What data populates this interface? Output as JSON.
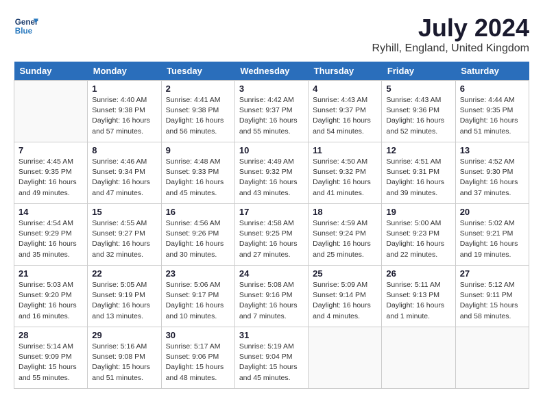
{
  "logo": {
    "line1": "General",
    "line2": "Blue"
  },
  "title": "July 2024",
  "location": "Ryhill, England, United Kingdom",
  "weekdays": [
    "Sunday",
    "Monday",
    "Tuesday",
    "Wednesday",
    "Thursday",
    "Friday",
    "Saturday"
  ],
  "weeks": [
    [
      {
        "day": "",
        "info": ""
      },
      {
        "day": "1",
        "info": "Sunrise: 4:40 AM\nSunset: 9:38 PM\nDaylight: 16 hours\nand 57 minutes."
      },
      {
        "day": "2",
        "info": "Sunrise: 4:41 AM\nSunset: 9:38 PM\nDaylight: 16 hours\nand 56 minutes."
      },
      {
        "day": "3",
        "info": "Sunrise: 4:42 AM\nSunset: 9:37 PM\nDaylight: 16 hours\nand 55 minutes."
      },
      {
        "day": "4",
        "info": "Sunrise: 4:43 AM\nSunset: 9:37 PM\nDaylight: 16 hours\nand 54 minutes."
      },
      {
        "day": "5",
        "info": "Sunrise: 4:43 AM\nSunset: 9:36 PM\nDaylight: 16 hours\nand 52 minutes."
      },
      {
        "day": "6",
        "info": "Sunrise: 4:44 AM\nSunset: 9:35 PM\nDaylight: 16 hours\nand 51 minutes."
      }
    ],
    [
      {
        "day": "7",
        "info": "Sunrise: 4:45 AM\nSunset: 9:35 PM\nDaylight: 16 hours\nand 49 minutes."
      },
      {
        "day": "8",
        "info": "Sunrise: 4:46 AM\nSunset: 9:34 PM\nDaylight: 16 hours\nand 47 minutes."
      },
      {
        "day": "9",
        "info": "Sunrise: 4:48 AM\nSunset: 9:33 PM\nDaylight: 16 hours\nand 45 minutes."
      },
      {
        "day": "10",
        "info": "Sunrise: 4:49 AM\nSunset: 9:32 PM\nDaylight: 16 hours\nand 43 minutes."
      },
      {
        "day": "11",
        "info": "Sunrise: 4:50 AM\nSunset: 9:32 PM\nDaylight: 16 hours\nand 41 minutes."
      },
      {
        "day": "12",
        "info": "Sunrise: 4:51 AM\nSunset: 9:31 PM\nDaylight: 16 hours\nand 39 minutes."
      },
      {
        "day": "13",
        "info": "Sunrise: 4:52 AM\nSunset: 9:30 PM\nDaylight: 16 hours\nand 37 minutes."
      }
    ],
    [
      {
        "day": "14",
        "info": "Sunrise: 4:54 AM\nSunset: 9:29 PM\nDaylight: 16 hours\nand 35 minutes."
      },
      {
        "day": "15",
        "info": "Sunrise: 4:55 AM\nSunset: 9:27 PM\nDaylight: 16 hours\nand 32 minutes."
      },
      {
        "day": "16",
        "info": "Sunrise: 4:56 AM\nSunset: 9:26 PM\nDaylight: 16 hours\nand 30 minutes."
      },
      {
        "day": "17",
        "info": "Sunrise: 4:58 AM\nSunset: 9:25 PM\nDaylight: 16 hours\nand 27 minutes."
      },
      {
        "day": "18",
        "info": "Sunrise: 4:59 AM\nSunset: 9:24 PM\nDaylight: 16 hours\nand 25 minutes."
      },
      {
        "day": "19",
        "info": "Sunrise: 5:00 AM\nSunset: 9:23 PM\nDaylight: 16 hours\nand 22 minutes."
      },
      {
        "day": "20",
        "info": "Sunrise: 5:02 AM\nSunset: 9:21 PM\nDaylight: 16 hours\nand 19 minutes."
      }
    ],
    [
      {
        "day": "21",
        "info": "Sunrise: 5:03 AM\nSunset: 9:20 PM\nDaylight: 16 hours\nand 16 minutes."
      },
      {
        "day": "22",
        "info": "Sunrise: 5:05 AM\nSunset: 9:19 PM\nDaylight: 16 hours\nand 13 minutes."
      },
      {
        "day": "23",
        "info": "Sunrise: 5:06 AM\nSunset: 9:17 PM\nDaylight: 16 hours\nand 10 minutes."
      },
      {
        "day": "24",
        "info": "Sunrise: 5:08 AM\nSunset: 9:16 PM\nDaylight: 16 hours\nand 7 minutes."
      },
      {
        "day": "25",
        "info": "Sunrise: 5:09 AM\nSunset: 9:14 PM\nDaylight: 16 hours\nand 4 minutes."
      },
      {
        "day": "26",
        "info": "Sunrise: 5:11 AM\nSunset: 9:13 PM\nDaylight: 16 hours\nand 1 minute."
      },
      {
        "day": "27",
        "info": "Sunrise: 5:12 AM\nSunset: 9:11 PM\nDaylight: 15 hours\nand 58 minutes."
      }
    ],
    [
      {
        "day": "28",
        "info": "Sunrise: 5:14 AM\nSunset: 9:09 PM\nDaylight: 15 hours\nand 55 minutes."
      },
      {
        "day": "29",
        "info": "Sunrise: 5:16 AM\nSunset: 9:08 PM\nDaylight: 15 hours\nand 51 minutes."
      },
      {
        "day": "30",
        "info": "Sunrise: 5:17 AM\nSunset: 9:06 PM\nDaylight: 15 hours\nand 48 minutes."
      },
      {
        "day": "31",
        "info": "Sunrise: 5:19 AM\nSunset: 9:04 PM\nDaylight: 15 hours\nand 45 minutes."
      },
      {
        "day": "",
        "info": ""
      },
      {
        "day": "",
        "info": ""
      },
      {
        "day": "",
        "info": ""
      }
    ]
  ]
}
